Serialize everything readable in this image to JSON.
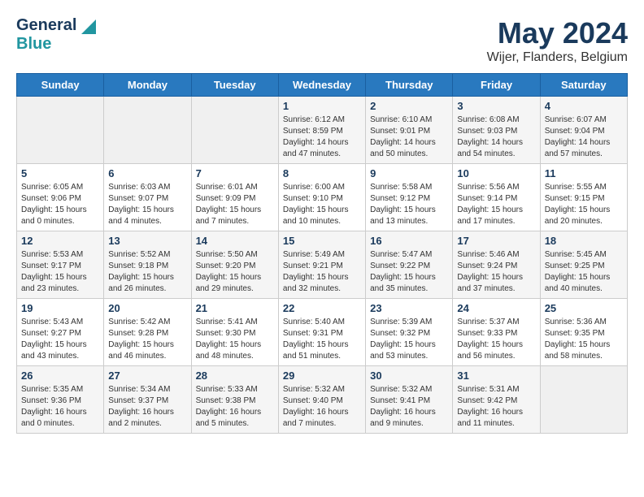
{
  "header": {
    "logo": {
      "line1": "General",
      "line2": "Blue"
    },
    "title": "May 2024",
    "subtitle": "Wijer, Flanders, Belgium"
  },
  "weekdays": [
    "Sunday",
    "Monday",
    "Tuesday",
    "Wednesday",
    "Thursday",
    "Friday",
    "Saturday"
  ],
  "weeks": [
    [
      {
        "day": "",
        "info": ""
      },
      {
        "day": "",
        "info": ""
      },
      {
        "day": "",
        "info": ""
      },
      {
        "day": "1",
        "info": "Sunrise: 6:12 AM\nSunset: 8:59 PM\nDaylight: 14 hours\nand 47 minutes."
      },
      {
        "day": "2",
        "info": "Sunrise: 6:10 AM\nSunset: 9:01 PM\nDaylight: 14 hours\nand 50 minutes."
      },
      {
        "day": "3",
        "info": "Sunrise: 6:08 AM\nSunset: 9:03 PM\nDaylight: 14 hours\nand 54 minutes."
      },
      {
        "day": "4",
        "info": "Sunrise: 6:07 AM\nSunset: 9:04 PM\nDaylight: 14 hours\nand 57 minutes."
      }
    ],
    [
      {
        "day": "5",
        "info": "Sunrise: 6:05 AM\nSunset: 9:06 PM\nDaylight: 15 hours\nand 0 minutes."
      },
      {
        "day": "6",
        "info": "Sunrise: 6:03 AM\nSunset: 9:07 PM\nDaylight: 15 hours\nand 4 minutes."
      },
      {
        "day": "7",
        "info": "Sunrise: 6:01 AM\nSunset: 9:09 PM\nDaylight: 15 hours\nand 7 minutes."
      },
      {
        "day": "8",
        "info": "Sunrise: 6:00 AM\nSunset: 9:10 PM\nDaylight: 15 hours\nand 10 minutes."
      },
      {
        "day": "9",
        "info": "Sunrise: 5:58 AM\nSunset: 9:12 PM\nDaylight: 15 hours\nand 13 minutes."
      },
      {
        "day": "10",
        "info": "Sunrise: 5:56 AM\nSunset: 9:14 PM\nDaylight: 15 hours\nand 17 minutes."
      },
      {
        "day": "11",
        "info": "Sunrise: 5:55 AM\nSunset: 9:15 PM\nDaylight: 15 hours\nand 20 minutes."
      }
    ],
    [
      {
        "day": "12",
        "info": "Sunrise: 5:53 AM\nSunset: 9:17 PM\nDaylight: 15 hours\nand 23 minutes."
      },
      {
        "day": "13",
        "info": "Sunrise: 5:52 AM\nSunset: 9:18 PM\nDaylight: 15 hours\nand 26 minutes."
      },
      {
        "day": "14",
        "info": "Sunrise: 5:50 AM\nSunset: 9:20 PM\nDaylight: 15 hours\nand 29 minutes."
      },
      {
        "day": "15",
        "info": "Sunrise: 5:49 AM\nSunset: 9:21 PM\nDaylight: 15 hours\nand 32 minutes."
      },
      {
        "day": "16",
        "info": "Sunrise: 5:47 AM\nSunset: 9:22 PM\nDaylight: 15 hours\nand 35 minutes."
      },
      {
        "day": "17",
        "info": "Sunrise: 5:46 AM\nSunset: 9:24 PM\nDaylight: 15 hours\nand 37 minutes."
      },
      {
        "day": "18",
        "info": "Sunrise: 5:45 AM\nSunset: 9:25 PM\nDaylight: 15 hours\nand 40 minutes."
      }
    ],
    [
      {
        "day": "19",
        "info": "Sunrise: 5:43 AM\nSunset: 9:27 PM\nDaylight: 15 hours\nand 43 minutes."
      },
      {
        "day": "20",
        "info": "Sunrise: 5:42 AM\nSunset: 9:28 PM\nDaylight: 15 hours\nand 46 minutes."
      },
      {
        "day": "21",
        "info": "Sunrise: 5:41 AM\nSunset: 9:30 PM\nDaylight: 15 hours\nand 48 minutes."
      },
      {
        "day": "22",
        "info": "Sunrise: 5:40 AM\nSunset: 9:31 PM\nDaylight: 15 hours\nand 51 minutes."
      },
      {
        "day": "23",
        "info": "Sunrise: 5:39 AM\nSunset: 9:32 PM\nDaylight: 15 hours\nand 53 minutes."
      },
      {
        "day": "24",
        "info": "Sunrise: 5:37 AM\nSunset: 9:33 PM\nDaylight: 15 hours\nand 56 minutes."
      },
      {
        "day": "25",
        "info": "Sunrise: 5:36 AM\nSunset: 9:35 PM\nDaylight: 15 hours\nand 58 minutes."
      }
    ],
    [
      {
        "day": "26",
        "info": "Sunrise: 5:35 AM\nSunset: 9:36 PM\nDaylight: 16 hours\nand 0 minutes."
      },
      {
        "day": "27",
        "info": "Sunrise: 5:34 AM\nSunset: 9:37 PM\nDaylight: 16 hours\nand 2 minutes."
      },
      {
        "day": "28",
        "info": "Sunrise: 5:33 AM\nSunset: 9:38 PM\nDaylight: 16 hours\nand 5 minutes."
      },
      {
        "day": "29",
        "info": "Sunrise: 5:32 AM\nSunset: 9:40 PM\nDaylight: 16 hours\nand 7 minutes."
      },
      {
        "day": "30",
        "info": "Sunrise: 5:32 AM\nSunset: 9:41 PM\nDaylight: 16 hours\nand 9 minutes."
      },
      {
        "day": "31",
        "info": "Sunrise: 5:31 AM\nSunset: 9:42 PM\nDaylight: 16 hours\nand 11 minutes."
      },
      {
        "day": "",
        "info": ""
      }
    ]
  ]
}
